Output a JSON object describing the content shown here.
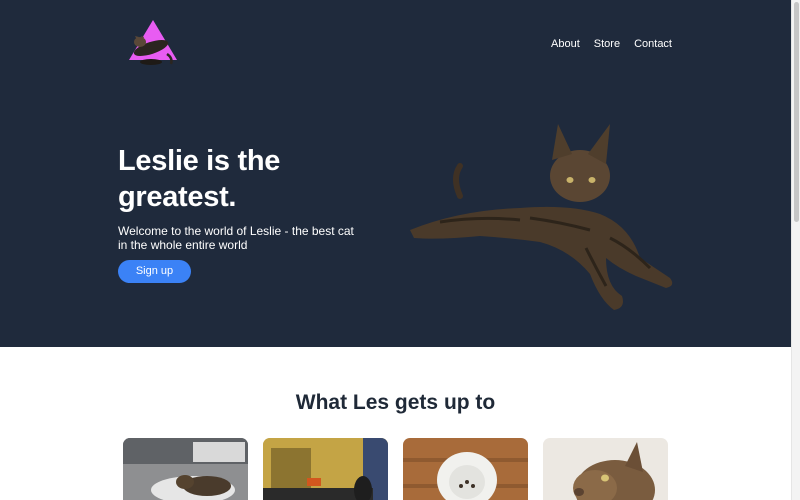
{
  "nav": {
    "items": [
      {
        "label": "About"
      },
      {
        "label": "Store"
      },
      {
        "label": "Contact"
      }
    ]
  },
  "hero": {
    "title": "Leslie is the greatest.",
    "subtitle": "Welcome to the world of Leslie - the best cat in the whole entire world",
    "cta_label": "Sign up"
  },
  "section": {
    "title": "What Les gets up to"
  },
  "colors": {
    "hero_bg": "#1f2a3c",
    "accent": "#3b82f6",
    "logo_triangle": "#e85cf2"
  },
  "icons": {
    "logo": "cat-on-triangle-logo"
  }
}
